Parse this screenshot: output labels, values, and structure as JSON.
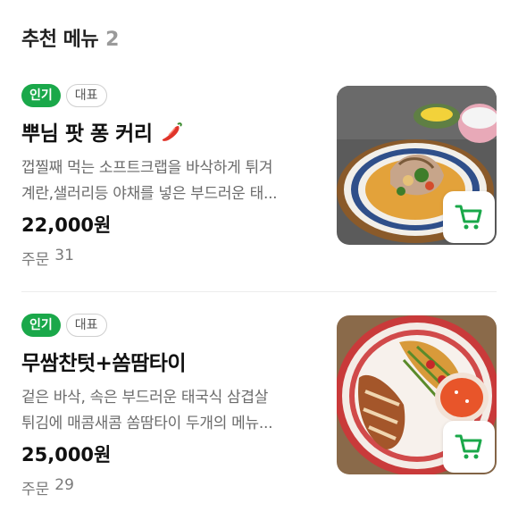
{
  "section": {
    "title": "추천 메뉴",
    "count": "2"
  },
  "items": [
    {
      "badges": [
        "인기",
        "대표"
      ],
      "name": "뿌님 팟 퐁 커리",
      "desc_line1": "껍찔째 먹는 소프트크랩을 바삭하게 튀겨",
      "desc_line2": "계란,샐러리등 야채를 넣은 부드러운 태...",
      "price": "22,000원",
      "orders_label": "주문",
      "orders_count": "31",
      "icon": "chili-pepper-icon"
    },
    {
      "badges": [
        "인기",
        "대표"
      ],
      "name": "무쌈찬텃+쏨땀타이",
      "desc_line1": "겉은 바삭, 속은 부드러운 태국식 삼겹살",
      "desc_line2": "튀김에 매콤새콤 쏨땀타이 두개의 메뉴...",
      "price": "25,000원",
      "orders_label": "주문",
      "orders_count": "29"
    }
  ],
  "colors": {
    "accent": "#1aa84a",
    "text_primary": "#111111",
    "text_secondary": "#6b6b6b"
  }
}
